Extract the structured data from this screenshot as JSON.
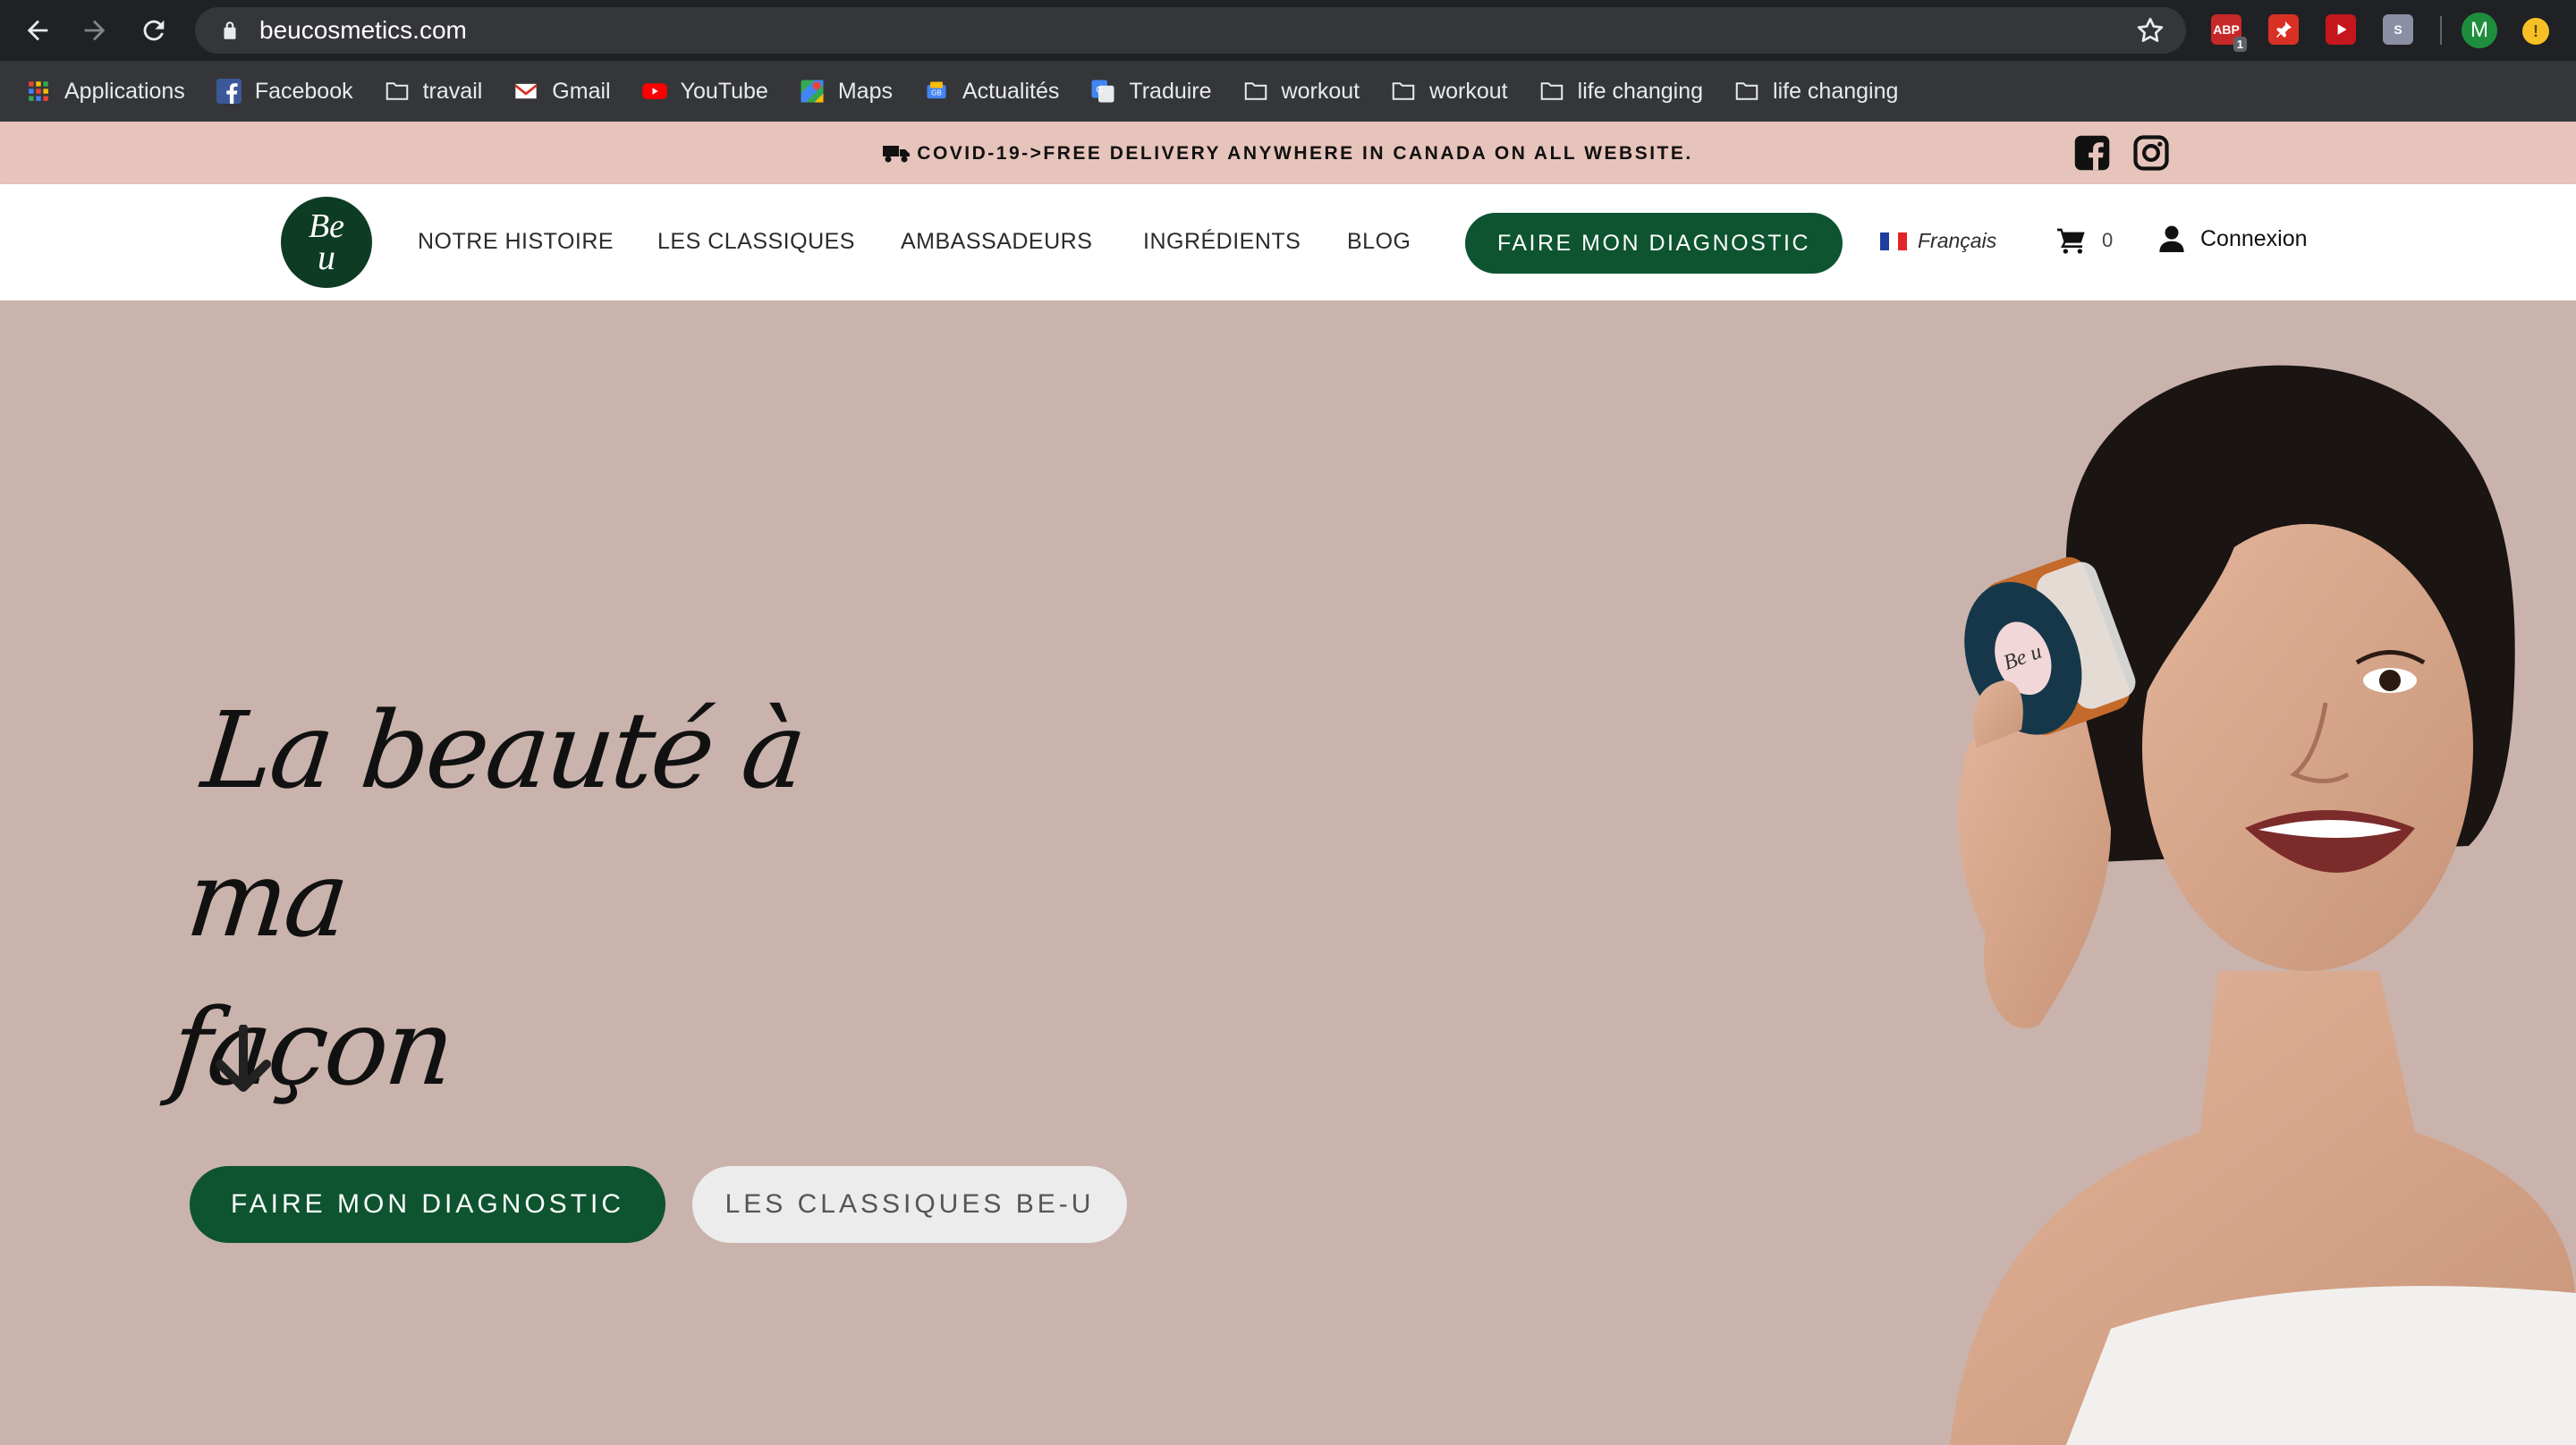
{
  "browser": {
    "url": "beucosmetics.com",
    "profile_initial": "M",
    "ext_badge": "1",
    "update_symbol": "!",
    "bookmarks": [
      {
        "label": "Applications",
        "icon": "apps-grid-icon"
      },
      {
        "label": "Facebook",
        "icon": "facebook-icon"
      },
      {
        "label": "travail",
        "icon": "folder-icon"
      },
      {
        "label": "Gmail",
        "icon": "gmail-icon"
      },
      {
        "label": "YouTube",
        "icon": "youtube-icon"
      },
      {
        "label": "Maps",
        "icon": "maps-icon"
      },
      {
        "label": "Actualités",
        "icon": "news-icon"
      },
      {
        "label": "Traduire",
        "icon": "translate-icon"
      },
      {
        "label": "workout",
        "icon": "folder-icon"
      },
      {
        "label": "workout",
        "icon": "folder-icon"
      },
      {
        "label": "life changing",
        "icon": "folder-icon"
      },
      {
        "label": "life changing",
        "icon": "folder-icon"
      }
    ]
  },
  "promo": {
    "text": "COVID-19->FREE DELIVERY ANYWHERE IN CANADA ON ALL WEBSITE."
  },
  "header": {
    "logo_line1": "Be",
    "logo_line2": "u",
    "menu": [
      "NOTRE HISTOIRE",
      "LES CLASSIQUES",
      "AMBASSADEURS",
      "INGRÉDIENTS",
      "BLOG"
    ],
    "cta": "FAIRE MON DIAGNOSTIC",
    "language": "Français",
    "cart_count": "0",
    "account": "Connexion"
  },
  "hero": {
    "title_line1": "La beauté à ma",
    "title_line2": "façon",
    "primary_button": "FAIRE MON DIAGNOSTIC",
    "secondary_button": "LES CLASSIQUES BE-U",
    "jar_text": "Be u"
  },
  "colors": {
    "brand_green": "#0e5431",
    "logo_green": "#0e3b24",
    "promo_bg": "#e7c4bb",
    "hero_bg": "#c9b3ac"
  }
}
